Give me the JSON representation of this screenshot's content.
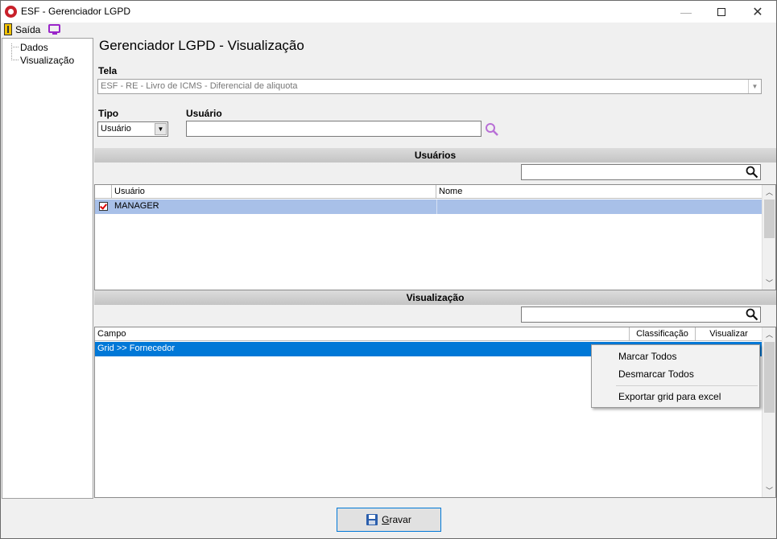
{
  "window": {
    "title": "ESF - Gerenciador LGPD",
    "minimize": "—",
    "close": "✕"
  },
  "menu": {
    "exit_label": "Saída"
  },
  "tree": {
    "items": [
      {
        "label": "Dados"
      },
      {
        "label": "Visualização"
      }
    ]
  },
  "main": {
    "heading": "Gerenciador LGPD - Visualização",
    "tela_label": "Tela",
    "tela_value": "ESF - RE - Livro de ICMS - Diferencial de aliquota",
    "tipo_label": "Tipo",
    "tipo_value": "Usuário",
    "usuario_label": "Usuário",
    "usuario_value": ""
  },
  "usuarios": {
    "section_title": "Usuários",
    "filter_value": "",
    "columns": [
      "Usuário",
      "Nome"
    ],
    "rows": [
      {
        "checked": true,
        "usuario": "MANAGER",
        "nome": ""
      }
    ]
  },
  "visualizacao": {
    "section_title": "Visualização",
    "filter_value": "",
    "columns": [
      "Campo",
      "Classificação",
      "Visualizar"
    ],
    "rows": [
      {
        "campo": "Grid >> Fornecedor"
      }
    ]
  },
  "context_menu": {
    "items": [
      "Marcar Todos",
      "Desmarcar Todos",
      "Exportar grid para excel"
    ]
  },
  "footer": {
    "save_label_underlined": "G",
    "save_label_rest": "ravar"
  },
  "colors": {
    "selected_row_blue": "#0078d7",
    "highlight_row_light": "#a8c0e8",
    "accent_purple": "#9a26c9"
  },
  "icons": [
    "app-icon",
    "exit-door-icon",
    "monitor-icon",
    "search-icon",
    "magnifier-icon",
    "floppy-disk-icon"
  ]
}
